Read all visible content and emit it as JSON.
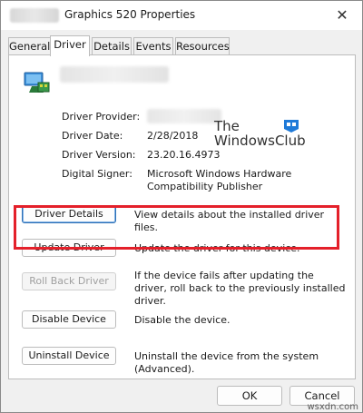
{
  "window": {
    "title": "Graphics 520 Properties",
    "close_glyph": "✕"
  },
  "tabs": [
    {
      "label": "General",
      "active": false
    },
    {
      "label": "Driver",
      "active": true
    },
    {
      "label": "Details",
      "active": false
    },
    {
      "label": "Events",
      "active": false
    },
    {
      "label": "Resources",
      "active": false
    }
  ],
  "device": {
    "icon": "display-adapter-icon"
  },
  "properties": [
    {
      "label": "Driver Provider:",
      "value": ""
    },
    {
      "label": "Driver Date:",
      "value": "2/28/2018"
    },
    {
      "label": "Driver Version:",
      "value": "23.20.16.4973"
    },
    {
      "label": "Digital Signer:",
      "value": "Microsoft Windows Hardware Compatibility Publisher"
    }
  ],
  "watermark": {
    "line1": "The",
    "line2": "WindowsClub"
  },
  "actions": [
    {
      "button": "Driver Details",
      "description": "View details about the installed driver files.",
      "enabled": true,
      "focused": true
    },
    {
      "button": "Update Driver",
      "description": "Update the driver for this device.",
      "enabled": true,
      "focused": false
    },
    {
      "button": "Roll Back Driver",
      "description": "If the device fails after updating the driver, roll back to the previously installed driver.",
      "enabled": false,
      "focused": false
    },
    {
      "button": "Disable Device",
      "description": "Disable the device.",
      "enabled": true,
      "focused": false
    },
    {
      "button": "Uninstall Device",
      "description": "Uninstall the device from the system (Advanced).",
      "enabled": true,
      "focused": false
    }
  ],
  "footer": {
    "ok": "OK",
    "cancel": "Cancel"
  },
  "site_watermark": "wsxdn.com",
  "colors": {
    "highlight": "#e4202a",
    "focus": "#2b6fb6"
  }
}
